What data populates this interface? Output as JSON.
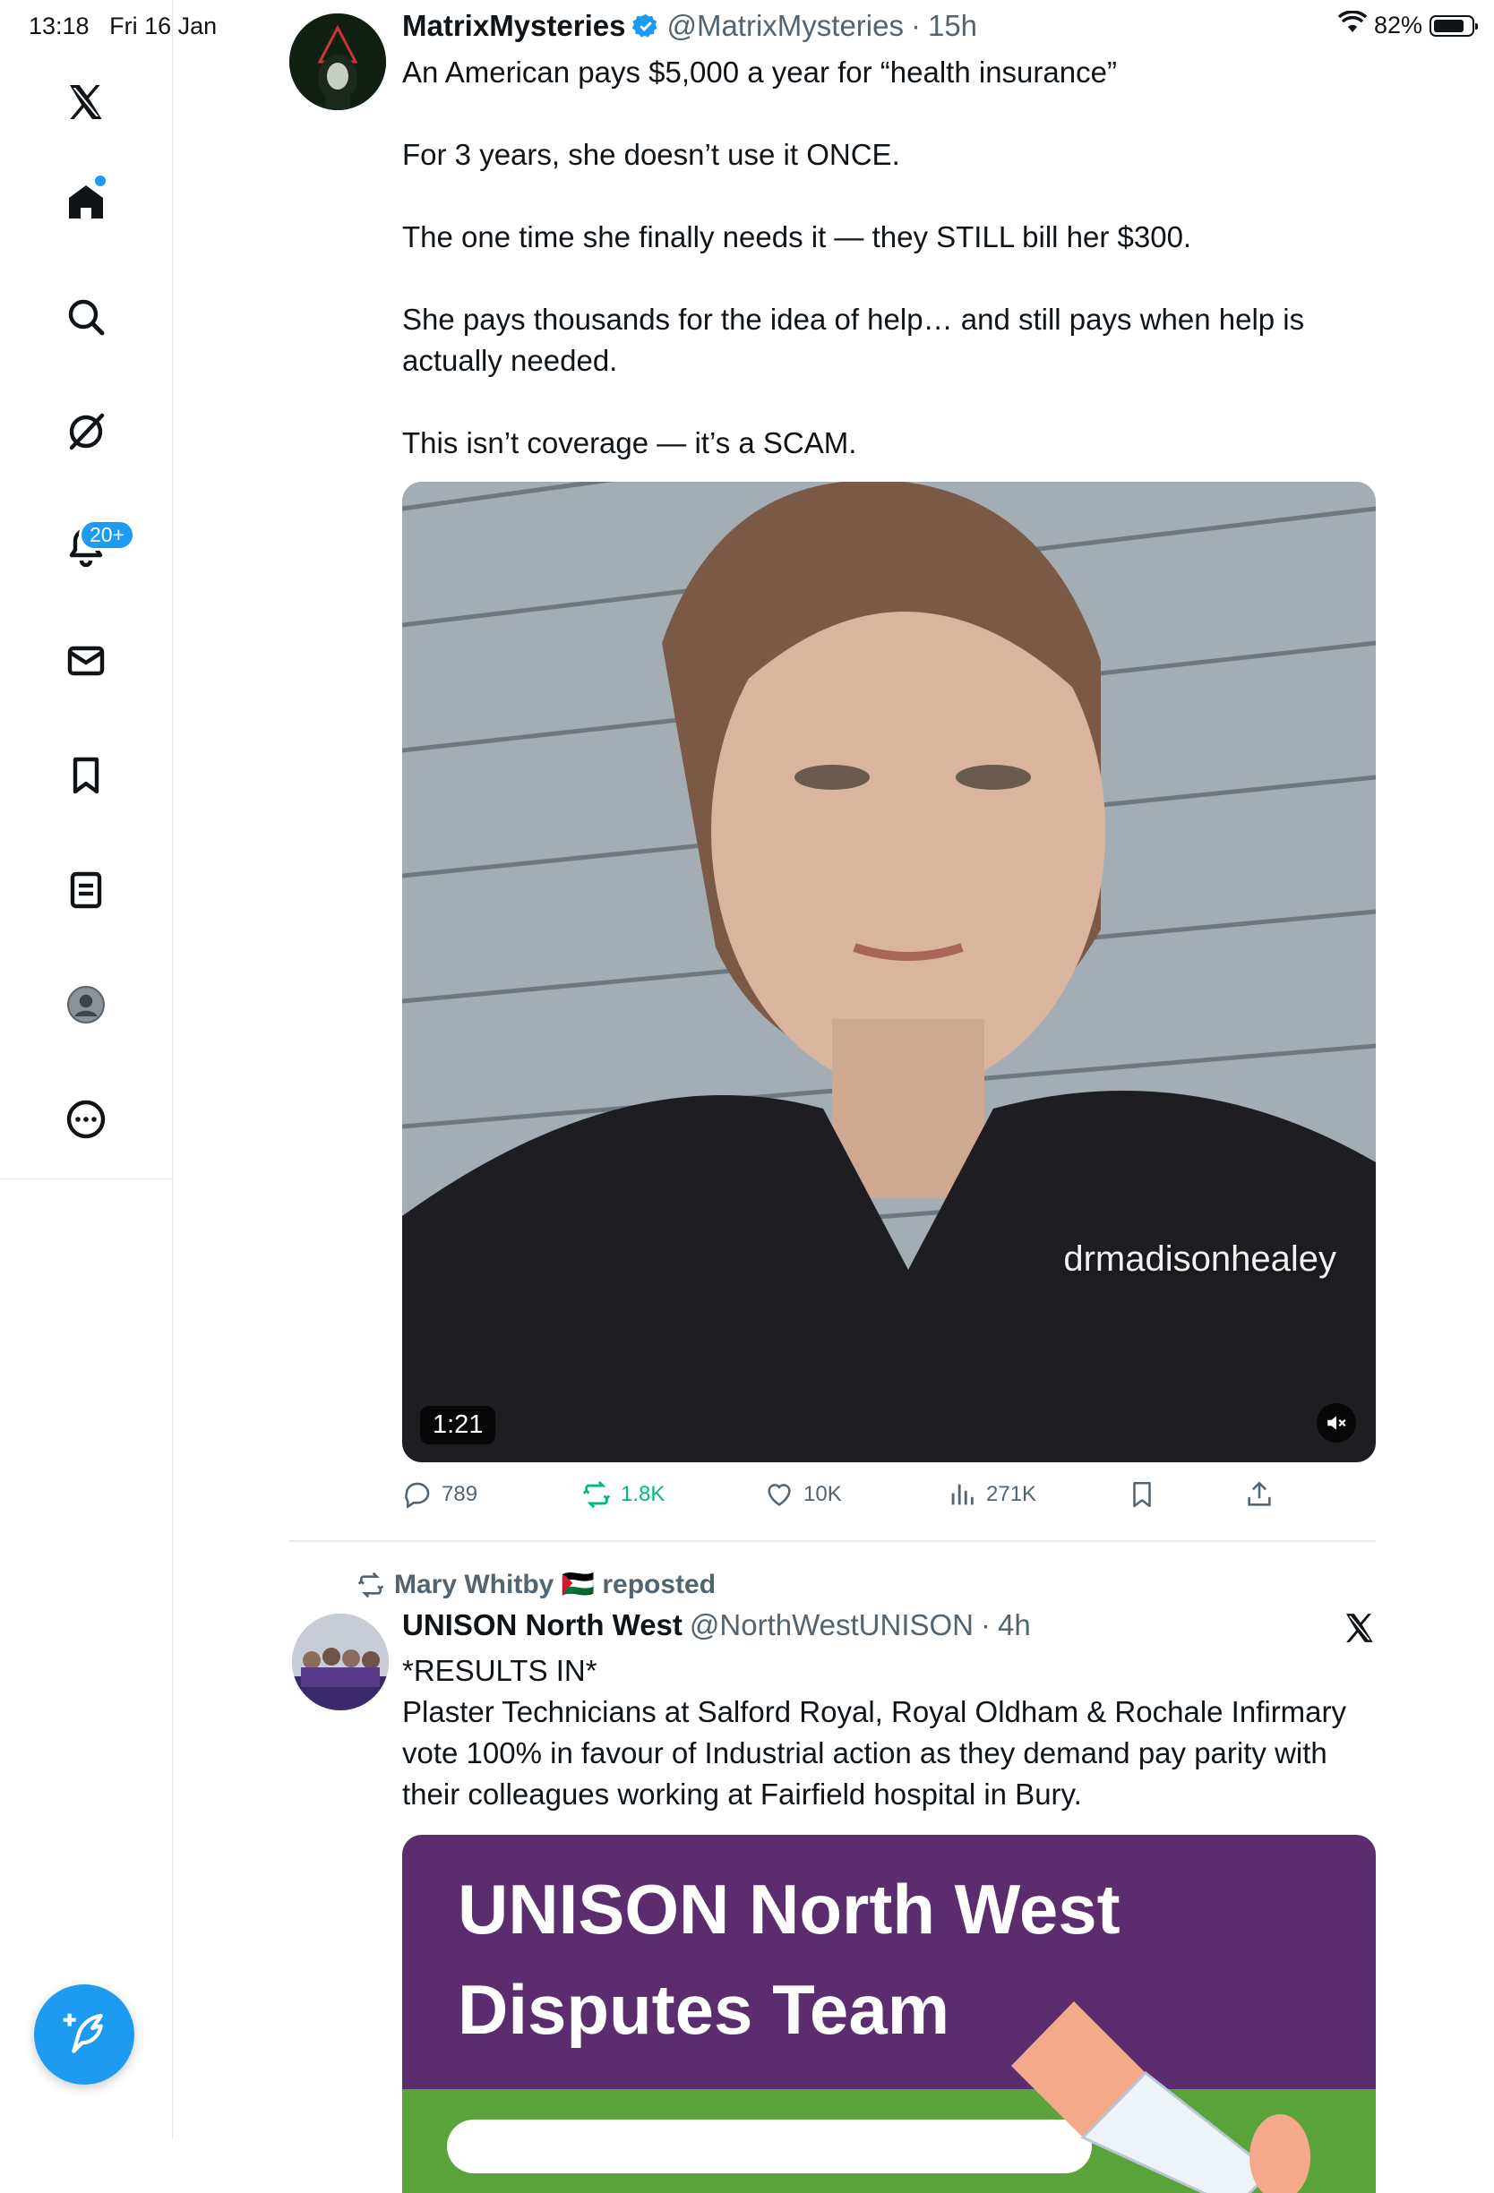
{
  "status_bar": {
    "time": "13:18",
    "date": "Fri 16 Jan",
    "battery": "82%",
    "battery_level": 0.82
  },
  "sidebar": {
    "items": [
      {
        "name": "x-logo",
        "icon": "x-logo-icon"
      },
      {
        "name": "home",
        "icon": "home-icon"
      },
      {
        "name": "search",
        "icon": "search-icon"
      },
      {
        "name": "grok",
        "icon": "grok-icon"
      },
      {
        "name": "notifications",
        "icon": "bell-icon",
        "badge": "20+"
      },
      {
        "name": "messages",
        "icon": "mail-icon"
      },
      {
        "name": "bookmarks",
        "icon": "bookmark-icon"
      },
      {
        "name": "lists",
        "icon": "list-icon"
      },
      {
        "name": "profile",
        "icon": "avatar-icon"
      },
      {
        "name": "more",
        "icon": "more-icon"
      }
    ]
  },
  "tweets": [
    {
      "name": "MatrixMysteries",
      "verified": true,
      "handle": "@MatrixMysteries",
      "time": "15h",
      "text": [
        "An American pays $5,000 a year for “health insurance”",
        "For 3 years, she doesn’t use it ONCE.",
        "The one time she finally needs it — they STILL bill her $300.",
        "She pays thousands for the idea of help… and still pays when help is actually needed.",
        "This isn’t coverage — it’s a SCAM."
      ],
      "media": {
        "duration": "1:21",
        "watermark": "drmadisonhealey"
      },
      "stats": {
        "replies": "789",
        "reposts": "1.8K",
        "likes": "10K",
        "views": "271K"
      }
    },
    {
      "repost_by": "Mary Whitby 🇵🇸 reposted",
      "name": "UNISON North West",
      "handle": "@NorthWestUNISON",
      "time": "4h",
      "text": [
        "*RESULTS IN*",
        "Plaster Technicians at Salford Royal, Royal Oldham & Rochale Infirmary vote 100% in favour of Industrial action as they demand pay parity with their colleagues working at Fairfield hospital in Bury."
      ],
      "card": {
        "line1": "UNISON North West",
        "line2": "Disputes Team"
      }
    }
  ],
  "colors": {
    "accent": "#1d9bf0",
    "text": "#0f1419",
    "secondary": "#536471",
    "repost_green": "#00ba7c",
    "card_purple": "#5c2d6e",
    "card_green": "#5aa33a"
  }
}
